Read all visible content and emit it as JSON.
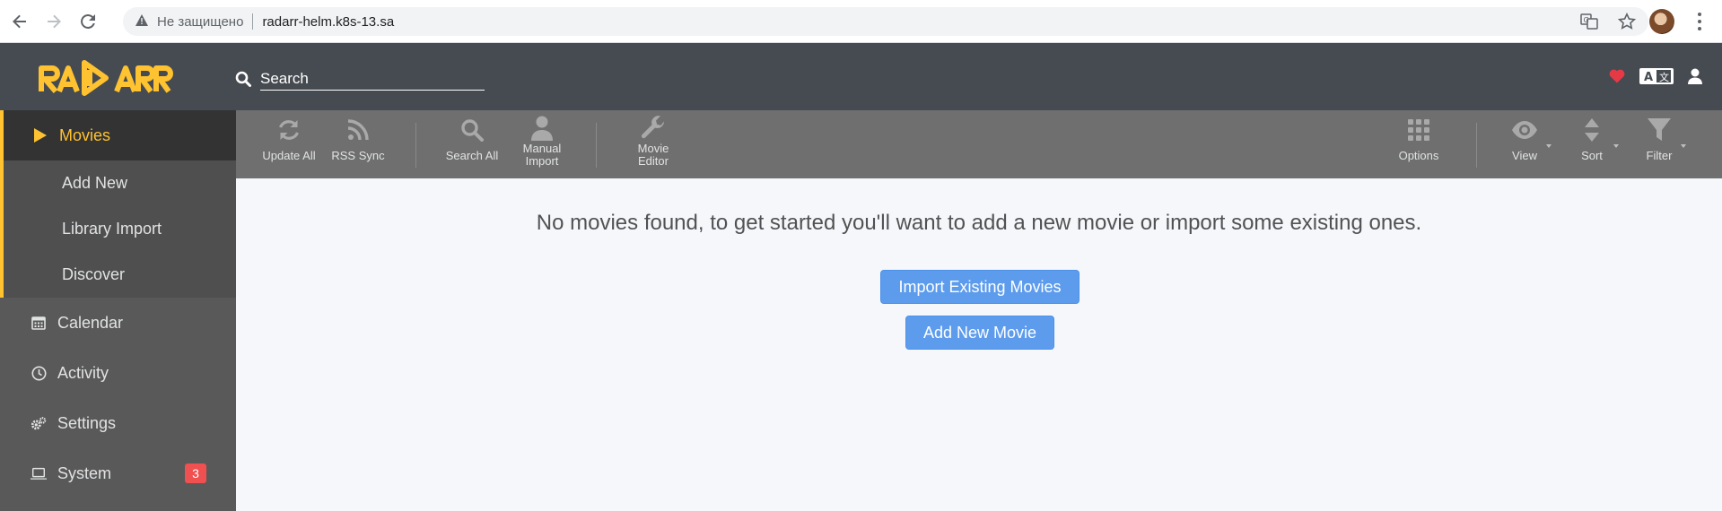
{
  "browser": {
    "insecure_label": "Не защищено",
    "url": "radarr-helm.k8s-13.sa"
  },
  "header": {
    "logo_text": "RADARR",
    "search_placeholder": "Search"
  },
  "sidebar": {
    "items": [
      {
        "label": "Movies",
        "icon": "play-icon",
        "active": true
      },
      {
        "label": "Add New"
      },
      {
        "label": "Library Import"
      },
      {
        "label": "Discover"
      },
      {
        "label": "Calendar",
        "icon": "calendar-icon"
      },
      {
        "label": "Activity",
        "icon": "clock-icon"
      },
      {
        "label": "Settings",
        "icon": "cogs-icon"
      },
      {
        "label": "System",
        "icon": "laptop-icon",
        "badge": "3"
      }
    ]
  },
  "toolbar": {
    "update_all": "Update All",
    "rss_sync": "RSS Sync",
    "search_all": "Search All",
    "manual_import_1": "Manual",
    "manual_import_2": "Import",
    "movie_editor_1": "Movie",
    "movie_editor_2": "Editor",
    "options": "Options",
    "view": "View",
    "sort": "Sort",
    "filter": "Filter"
  },
  "main": {
    "empty_message": "No movies found, to get started you'll want to add a new movie or import some existing ones.",
    "import_button": "Import Existing Movies",
    "add_button": "Add New Movie"
  },
  "colors": {
    "accent": "#ffc230",
    "button_primary": "#5d9cec",
    "header_bg": "#464b51",
    "sidebar_bg": "#595959",
    "toolbar_bg": "#6f6f6f",
    "badge": "#f05050"
  }
}
